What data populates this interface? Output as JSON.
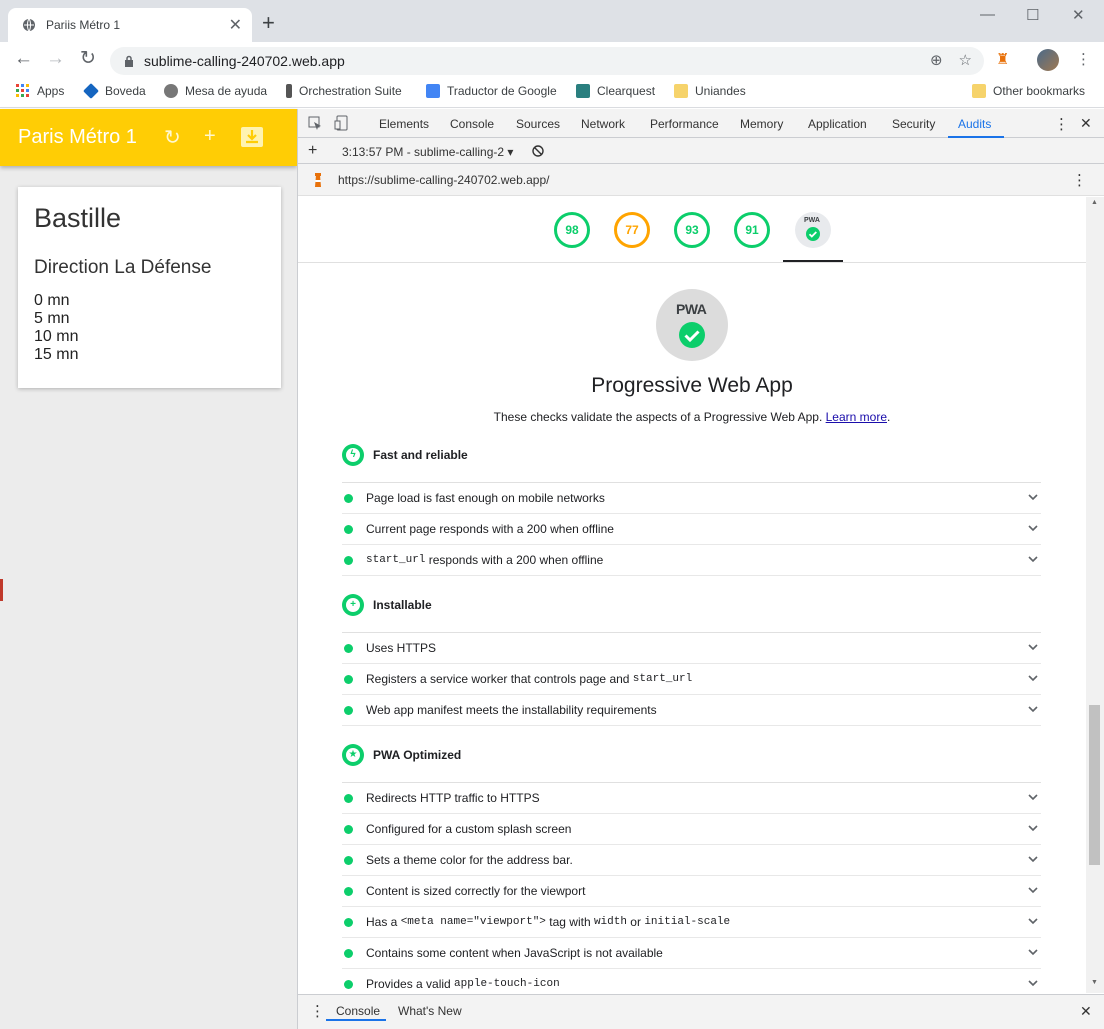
{
  "browser": {
    "tab_title": "Pariis Métro 1",
    "url": "sublime-calling-240702.web.app",
    "bookmarks": [
      "Apps",
      "Boveda",
      "Mesa de ayuda",
      "Orchestration Suite",
      "Traductor de Google",
      "Clearquest",
      "Uniandes"
    ],
    "other_bookmarks": "Other bookmarks"
  },
  "app": {
    "title": "Paris Métro 1",
    "station": "Bastille",
    "direction": "Direction La Défense",
    "times": [
      "0 mn",
      "5 mn",
      "10 mn",
      "15 mn"
    ],
    "accent_color": "#ffcd05"
  },
  "devtools": {
    "tabs": [
      "Elements",
      "Console",
      "Sources",
      "Network",
      "Performance",
      "Memory",
      "Application",
      "Security",
      "Audits"
    ],
    "active_tab": "Audits",
    "report_select": "3:13:57 PM - sublime-calling-2",
    "audited_url": "https://sublime-calling-240702.web.app/",
    "drawer_tabs": [
      "Console",
      "What's New"
    ]
  },
  "report": {
    "scores": [
      "98",
      "77",
      "93",
      "91"
    ],
    "pwa_badge": "PWA",
    "title": "Progressive Web App",
    "description": "These checks validate the aspects of a Progressive Web App.",
    "learn_more": "Learn more",
    "groups": [
      {
        "name": "Fast and reliable",
        "icon": "lightning-icon",
        "audits": [
          {
            "text": "Page load is fast enough on mobile networks"
          },
          {
            "text": "Current page responds with a 200 when offline"
          },
          {
            "code1": "start_url",
            "text": " responds with a 200 when offline"
          }
        ]
      },
      {
        "name": "Installable",
        "icon": "plus-icon",
        "audits": [
          {
            "text": "Uses HTTPS"
          },
          {
            "text": "Registers a service worker that controls page and ",
            "code1": "start_url"
          },
          {
            "text": "Web app manifest meets the installability requirements"
          }
        ]
      },
      {
        "name": "PWA Optimized",
        "icon": "star-icon",
        "audits": [
          {
            "text": "Redirects HTTP traffic to HTTPS"
          },
          {
            "text": "Configured for a custom splash screen"
          },
          {
            "text": "Sets a theme color for the address bar."
          },
          {
            "text": "Content is sized correctly for the viewport"
          },
          {
            "text": "Has a ",
            "code1": "<meta name=\"viewport\">",
            "text2": " tag with ",
            "code2": "width",
            "text3": " or ",
            "code3": "initial-scale"
          },
          {
            "text": "Contains some content when JavaScript is not available"
          },
          {
            "text": "Provides a valid ",
            "code1": "apple-touch-icon"
          }
        ]
      }
    ],
    "pass_color": "#0cce6b",
    "average_color": "#ffa400"
  }
}
